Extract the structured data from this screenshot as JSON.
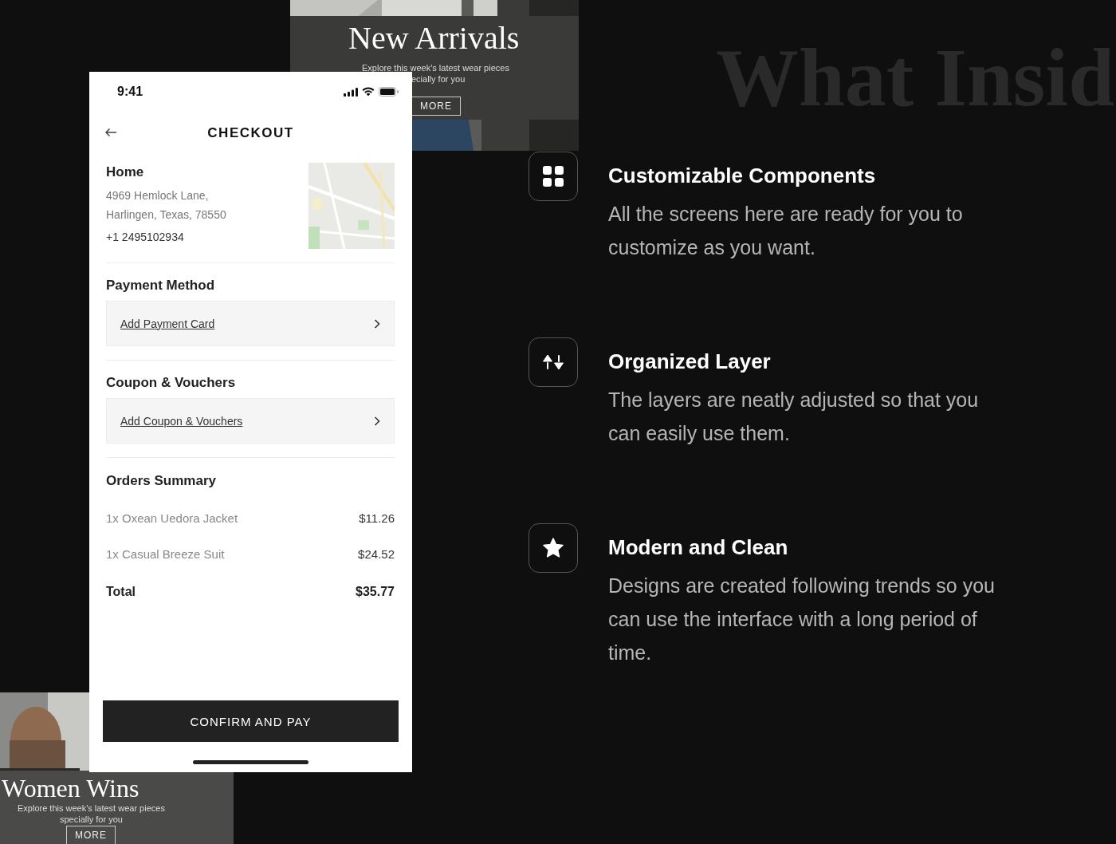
{
  "heading": "What Insid",
  "top_banner": {
    "kind": "picture",
    "title": "New Arrivals",
    "subtitle_lines": [
      "Explore this week's latest wear pieces",
      "ecially for you"
    ],
    "button": "MORE"
  },
  "bottom_banner": {
    "kind": "picture",
    "title": "Women Wins",
    "subtitle_lines": [
      "Explore this week's latest wear pieces",
      "specially for you"
    ],
    "button": "MORE"
  },
  "phone": {
    "status_bar": {
      "time": "9:41"
    },
    "title": "CHECKOUT",
    "address": {
      "label": "Home",
      "lines": [
        "4969  Hemlock Lane,",
        "Harlingen, Texas, 78550"
      ],
      "phone": "+1 2495102934",
      "map": {
        "kind": "picture"
      }
    },
    "sections": [
      {
        "title": "Payment Method",
        "action": "Add Payment Card"
      },
      {
        "title": "Coupon & Vouchers",
        "action": "Add Coupon & Vouchers"
      }
    ],
    "summary": {
      "title": "Orders Summary",
      "items": [
        {
          "name": "1x Oxean Uedora Jacket",
          "price": "$11.26"
        },
        {
          "name": "1x Casual Breeze Suit",
          "price": "$24.52"
        }
      ],
      "total_label": "Total",
      "total": "$35.77"
    },
    "confirm_button": "CONFIRM AND PAY"
  },
  "features": [
    {
      "title": "Customizable Components",
      "text": "All the screens here are ready for you to customize as you want."
    },
    {
      "title": "Organized Layer",
      "text": "The layers are neatly adjusted so that you can easily use them."
    },
    {
      "title": "Modern and Clean",
      "text": "Designs are created following trends so you can use the interface with a long period of time."
    }
  ]
}
